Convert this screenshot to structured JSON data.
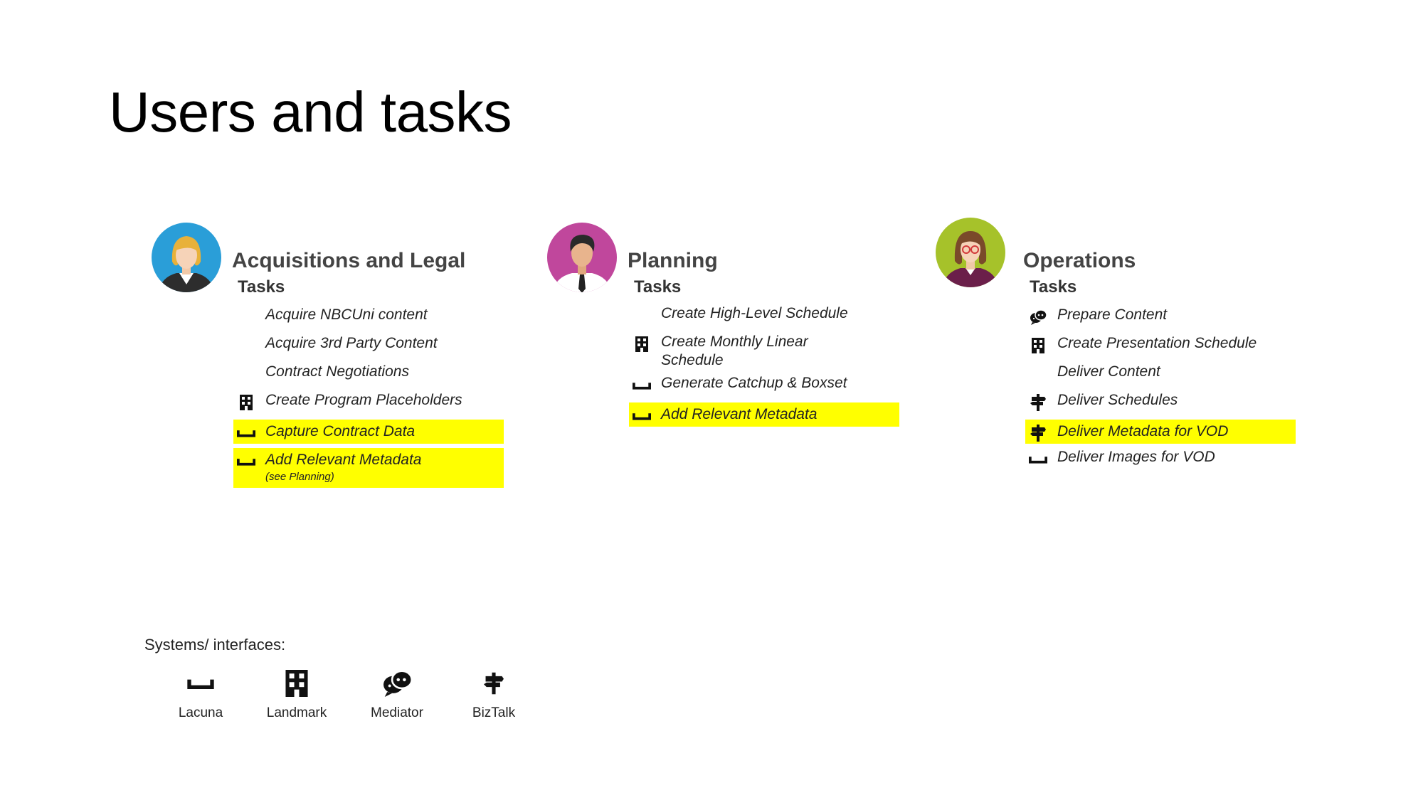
{
  "page": {
    "title": "Users and tasks"
  },
  "columns": [
    {
      "role": "Acquisitions and Legal",
      "tasks_label": "Tasks",
      "avatar": "woman-blonde-avatar",
      "tasks": [
        {
          "label": "Acquire NBCUni content",
          "icon": "",
          "highlight": false
        },
        {
          "label": "Acquire 3rd Party Content",
          "icon": "",
          "highlight": false
        },
        {
          "label": "Contract Negotiations",
          "icon": "",
          "highlight": false
        },
        {
          "label": "Create Program Placeholders",
          "icon": "landmark-icon",
          "highlight": false
        },
        {
          "label": "Capture Contract Data",
          "icon": "lacuna-icon",
          "highlight": true
        },
        {
          "label": "Add Relevant Metadata",
          "note": "(see Planning)",
          "icon": "lacuna-icon",
          "highlight": true
        }
      ]
    },
    {
      "role": "Planning",
      "tasks_label": "Tasks",
      "avatar": "man-tie-avatar",
      "tasks": [
        {
          "label": "Create High-Level Schedule",
          "icon": "",
          "highlight": false
        },
        {
          "label": "Create Monthly Linear Schedule",
          "icon": "landmark-icon",
          "highlight": false
        },
        {
          "label": "Generate Catchup & Boxset",
          "icon": "lacuna-icon",
          "highlight": false
        },
        {
          "label": "Add Relevant Metadata",
          "icon": "lacuna-icon",
          "highlight": true
        }
      ]
    },
    {
      "role": "Operations",
      "tasks_label": "Tasks",
      "avatar": "woman-glasses-avatar",
      "tasks": [
        {
          "label": "Prepare Content",
          "icon": "mediator-icon",
          "highlight": false
        },
        {
          "label": "Create Presentation Schedule",
          "icon": "landmark-icon",
          "highlight": false
        },
        {
          "label": "Deliver Content",
          "icon": "",
          "highlight": false
        },
        {
          "label": "Deliver Schedules",
          "icon": "biztalk-icon",
          "highlight": false
        },
        {
          "label": "Deliver Metadata for VOD",
          "icon": "biztalk-icon",
          "highlight": true
        },
        {
          "label": "Deliver Images for VOD",
          "icon": "lacuna-icon",
          "highlight": false
        }
      ]
    }
  ],
  "legend": {
    "title": "Systems/ interfaces:",
    "items": [
      {
        "label": "Lacuna",
        "icon": "lacuna-icon"
      },
      {
        "label": "Landmark",
        "icon": "landmark-icon"
      },
      {
        "label": "Mediator",
        "icon": "mediator-icon"
      },
      {
        "label": "BizTalk",
        "icon": "biztalk-icon"
      }
    ]
  },
  "colors": {
    "highlight": "#ffff00",
    "avatar_acquisitions": "#2a9ed8",
    "avatar_planning": "#c0479c",
    "avatar_operations": "#a6c22a"
  }
}
